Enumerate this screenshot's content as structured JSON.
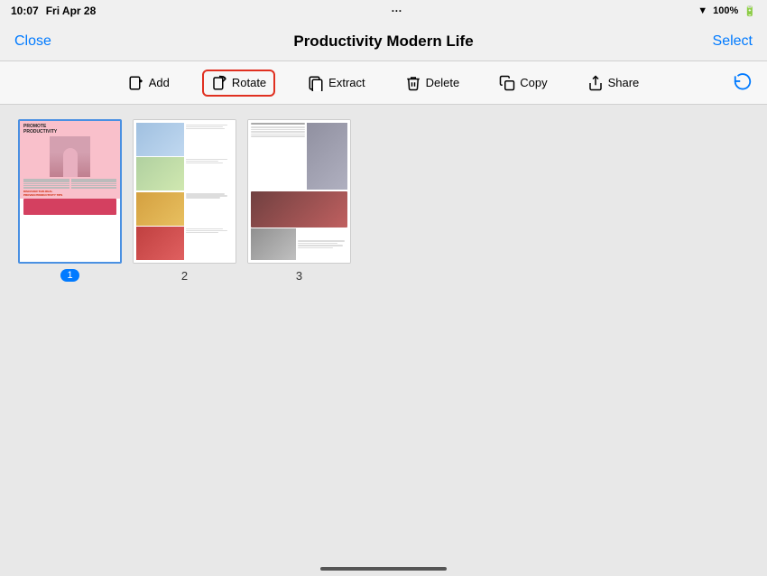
{
  "statusBar": {
    "time": "10:07",
    "day": "Fri Apr 28",
    "ellipsis": "···",
    "wifi": "📶",
    "battery": "100%"
  },
  "nav": {
    "close": "Close",
    "title": "Productivity Modern Life",
    "select": "Select"
  },
  "toolbar": {
    "add": "Add",
    "rotate": "Rotate",
    "extract": "Extract",
    "delete": "Delete",
    "copy": "Copy",
    "share": "Share"
  },
  "pages": [
    {
      "num": "1",
      "badge": "1",
      "selected": true
    },
    {
      "num": "2",
      "badge": null,
      "selected": false
    },
    {
      "num": "3",
      "badge": null,
      "selected": false
    }
  ]
}
